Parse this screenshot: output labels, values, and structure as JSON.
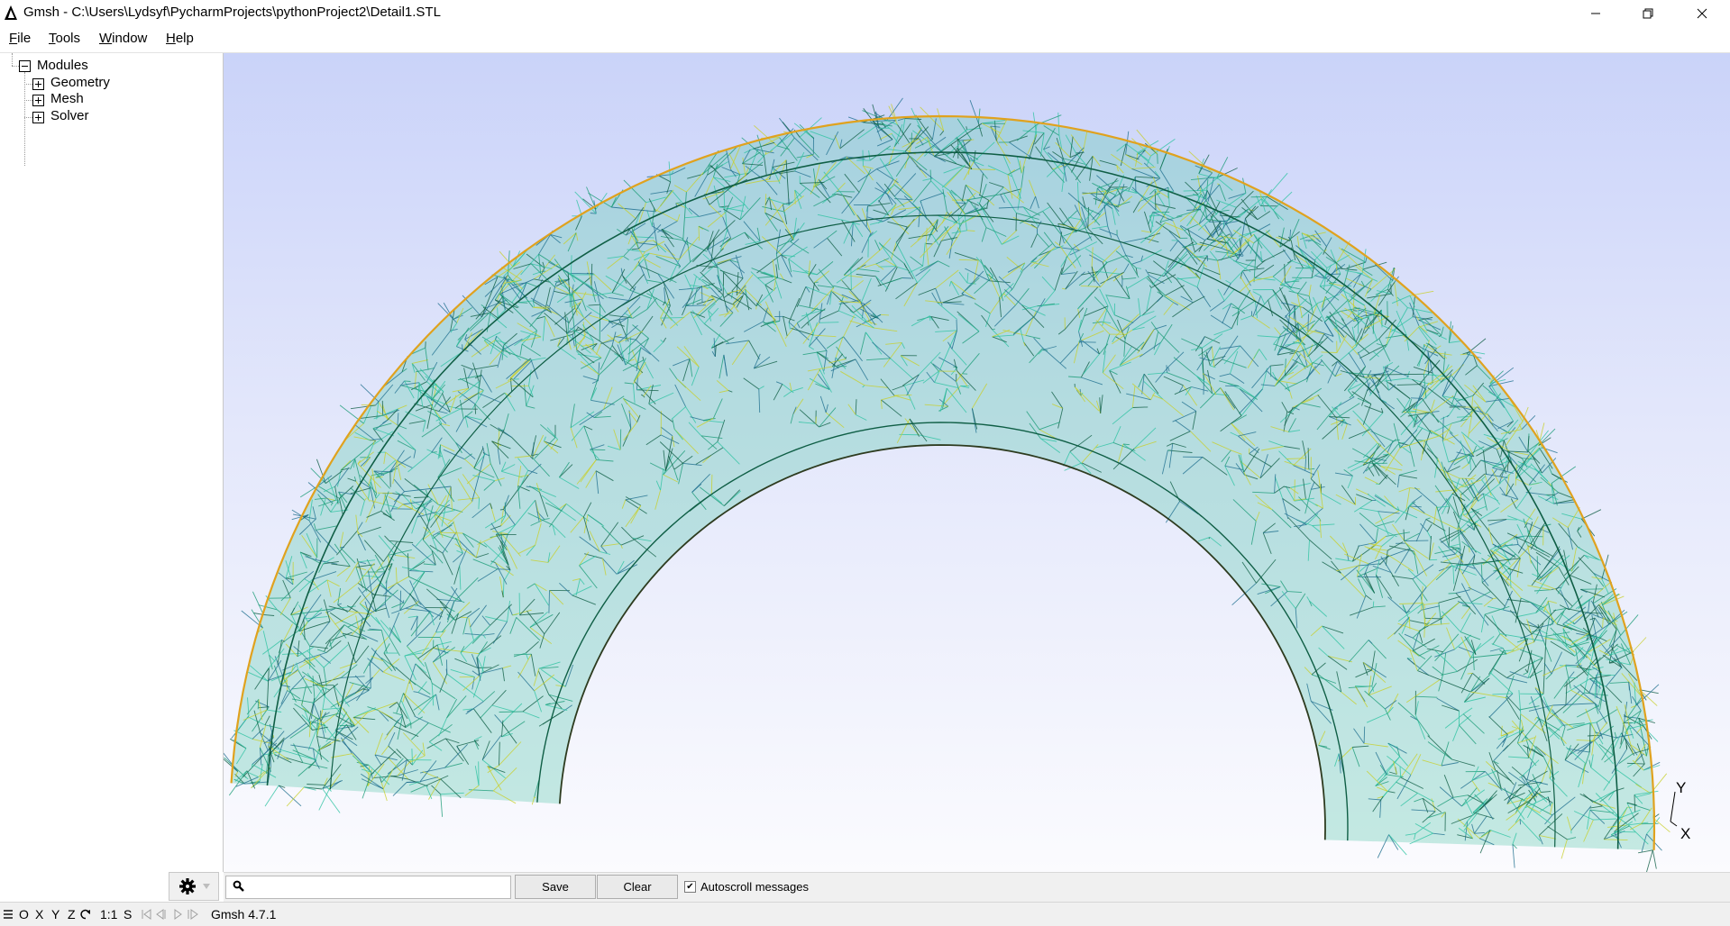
{
  "window": {
    "title": "Gmsh - C:\\Users\\Lydsyf\\PycharmProjects\\pythonProject2\\Detail1.STL",
    "controls": {
      "minimize": "minimize",
      "restore": "restore",
      "close": "close"
    }
  },
  "menu": {
    "file": "File",
    "tools": "Tools",
    "window": "Window",
    "help": "Help"
  },
  "tree": {
    "root": "Modules",
    "children": [
      {
        "label": "Geometry",
        "expanded": false
      },
      {
        "label": "Mesh",
        "expanded": false
      },
      {
        "label": "Solver",
        "expanded": false
      }
    ]
  },
  "viewport": {
    "axes": {
      "y": "Y",
      "x": "X"
    },
    "background_top": "#cad3f9",
    "background_bottom": "#fbfbfe",
    "mesh_colors": [
      "#0f5e45",
      "#1a9b77",
      "#2ec3a3",
      "#1f6f8f",
      "#c8d02a",
      "#e0a21e"
    ]
  },
  "messages": {
    "search_value": "",
    "save_label": "Save",
    "clear_label": "Clear",
    "autoscroll_label": "Autoscroll messages",
    "autoscroll_checked": true
  },
  "statusbar": {
    "menu_icon": "list-icon",
    "o": "O",
    "x": "X",
    "y": "Y",
    "z": "Z",
    "rotate_icon": "rotate-icon",
    "scale": "1:1",
    "s": "S",
    "version": "Gmsh 4.7.1"
  }
}
